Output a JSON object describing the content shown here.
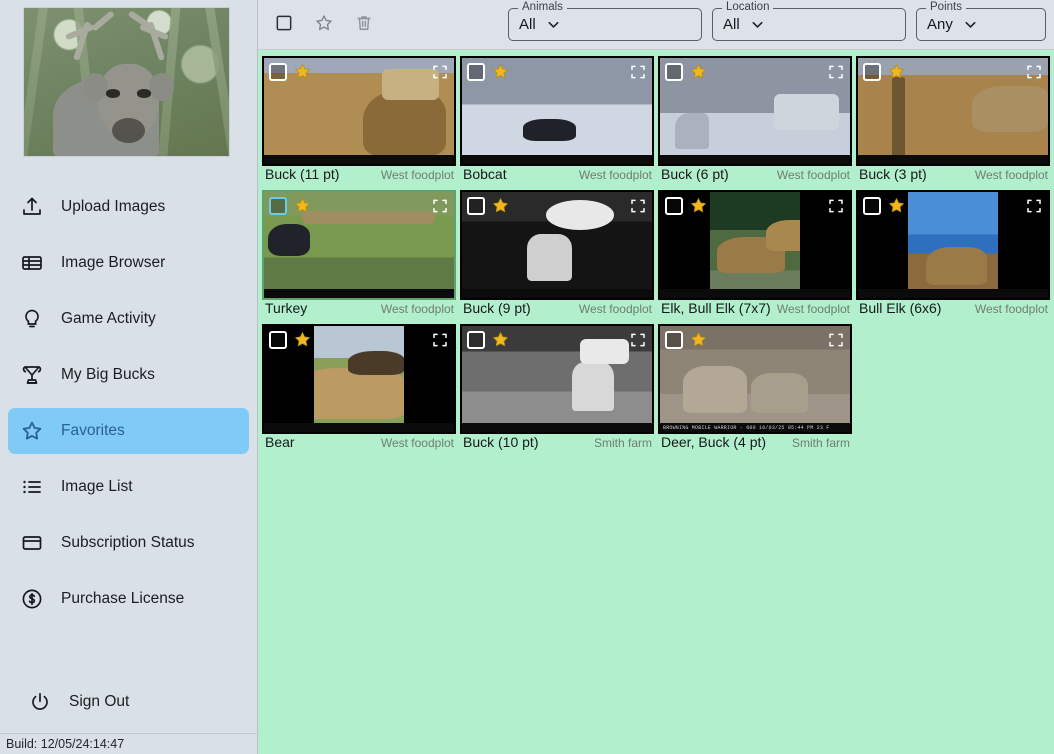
{
  "sidebar": {
    "hero_alt": "buck-in-cornfield-photo",
    "items": [
      {
        "label": "Upload Images",
        "icon": "upload-icon",
        "active": false
      },
      {
        "label": "Image Browser",
        "icon": "table-icon",
        "active": false
      },
      {
        "label": "Game Activity",
        "icon": "lightbulb-icon",
        "active": false
      },
      {
        "label": "My Big Bucks",
        "icon": "trophy-icon",
        "active": false
      },
      {
        "label": "Favorites",
        "icon": "star-icon",
        "active": true
      },
      {
        "label": "Image List",
        "icon": "list-icon",
        "active": false
      },
      {
        "label": "Subscription Status",
        "icon": "inbox-icon",
        "active": false
      },
      {
        "label": "Purchase License",
        "icon": "dollar-circle-icon",
        "active": false
      }
    ],
    "sign_out": {
      "label": "Sign Out",
      "icon": "power-icon"
    },
    "build": "Build: 12/05/24:14:47"
  },
  "toolbar": {
    "select_all_icon": "checkbox-icon",
    "favorite_icon": "star-outline-icon",
    "delete_icon": "trash-icon",
    "filters": [
      {
        "legend": "Animals",
        "value": "All",
        "name": "animals-filter"
      },
      {
        "legend": "Location",
        "value": "All",
        "name": "location-filter"
      },
      {
        "legend": "Points",
        "value": "Any",
        "name": "points-filter"
      }
    ]
  },
  "colors": {
    "main_background": "#b2f0cd",
    "sidebar_background": "#dae0e8",
    "active_item": "#7fcbf5",
    "active_item_text": "#2b5f96",
    "star": "#f0b81e",
    "caption_location": "#6e7d72"
  },
  "gallery": {
    "rows": [
      [
        {
          "title": "Buck (11 pt)",
          "location": "West foodplot",
          "starred": true,
          "checked": false,
          "selected": false,
          "scene": "brush-buck",
          "fit": "fill",
          "timestamp": ""
        },
        {
          "title": "Bobcat",
          "location": "West foodplot",
          "starred": true,
          "checked": false,
          "selected": false,
          "scene": "snow-bobcat",
          "fit": "fill",
          "timestamp": ""
        },
        {
          "title": "Buck (6 pt)",
          "location": "West foodplot",
          "starred": true,
          "checked": false,
          "selected": false,
          "scene": "snow-buck",
          "fit": "fill",
          "timestamp": ""
        },
        {
          "title": "Buck (3 pt)",
          "location": "West foodplot",
          "starred": true,
          "checked": false,
          "selected": false,
          "scene": "woods-buck",
          "fit": "fill",
          "timestamp": ""
        }
      ],
      [
        {
          "title": "Turkey",
          "location": "West foodplot",
          "starred": true,
          "checked": false,
          "selected": true,
          "scene": "turkey-field",
          "fit": "fill",
          "timestamp": ""
        },
        {
          "title": "Buck (9 pt)",
          "location": "West foodplot",
          "starred": true,
          "checked": false,
          "selected": false,
          "scene": "night-buck",
          "fit": "fill",
          "timestamp": ""
        },
        {
          "title": "Elk, Bull Elk (7x7)",
          "location": "West foodplot",
          "starred": true,
          "checked": false,
          "selected": false,
          "scene": "elk-pair",
          "fit": "pillar",
          "timestamp": ""
        },
        {
          "title": "Bull Elk (6x6)",
          "location": "West foodplot",
          "starred": true,
          "checked": false,
          "selected": false,
          "scene": "elk-lake",
          "fit": "pillar",
          "timestamp": ""
        }
      ],
      [
        {
          "title": "Bear",
          "location": "West foodplot",
          "starred": true,
          "checked": false,
          "selected": false,
          "scene": "bear-cub",
          "fit": "pillar",
          "timestamp": ""
        },
        {
          "title": "Buck (10 pt)",
          "location": "Smith farm",
          "starred": true,
          "checked": false,
          "selected": false,
          "scene": "ir-buck",
          "fit": "fill",
          "timestamp": ""
        },
        {
          "title": "Deer, Buck (4 pt)",
          "location": "Smith farm",
          "starred": true,
          "checked": false,
          "selected": false,
          "scene": "two-deer",
          "fit": "fill",
          "timestamp": "BROWNING MOBILE  WARRIOR - 600         10/03/25 05:44 PM   23 F"
        }
      ]
    ]
  }
}
